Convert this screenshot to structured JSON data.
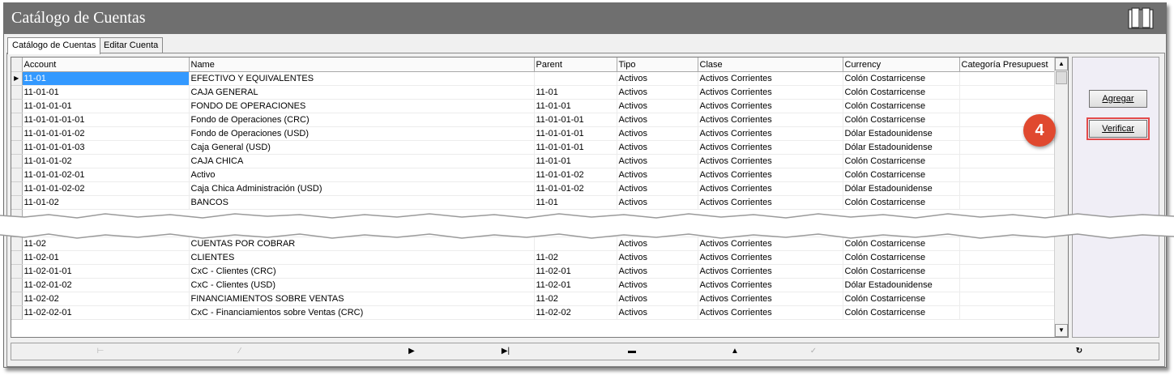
{
  "window": {
    "title": "Catálogo de Cuentas"
  },
  "tabs": [
    {
      "label": "Catálogo de Cuentas"
    },
    {
      "label": "Editar Cuenta"
    }
  ],
  "grid": {
    "columns": [
      "Account",
      "Name",
      "Parent",
      "Tipo",
      "Clase",
      "Currency",
      "Categoría Presupuest"
    ],
    "rows_top": [
      [
        "11-01",
        "EFECTIVO Y EQUIVALENTES",
        "",
        "Activos",
        "Activos Corrientes",
        "Colón Costarricense",
        ""
      ],
      [
        "11-01-01",
        "CAJA GENERAL",
        "11-01",
        "Activos",
        "Activos Corrientes",
        "Colón Costarricense",
        ""
      ],
      [
        "11-01-01-01",
        "FONDO DE OPERACIONES",
        "11-01-01",
        "Activos",
        "Activos Corrientes",
        "Colón Costarricense",
        ""
      ],
      [
        "11-01-01-01-01",
        "Fondo de Operaciones (CRC)",
        "11-01-01-01",
        "Activos",
        "Activos Corrientes",
        "Colón Costarricense",
        ""
      ],
      [
        "11-01-01-01-02",
        "Fondo de Operaciones (USD)",
        "11-01-01-01",
        "Activos",
        "Activos Corrientes",
        "Dólar Estadounidense",
        ""
      ],
      [
        "11-01-01-01-03",
        "Caja General (USD)",
        "11-01-01-01",
        "Activos",
        "Activos Corrientes",
        "Dólar Estadounidense",
        ""
      ],
      [
        "11-01-01-02",
        "CAJA CHICA",
        "11-01-01",
        "Activos",
        "Activos Corrientes",
        "Colón Costarricense",
        ""
      ],
      [
        "11-01-01-02-01",
        "Activo",
        "11-01-01-02",
        "Activos",
        "Activos Corrientes",
        "Colón Costarricense",
        ""
      ],
      [
        "11-01-01-02-02",
        "Caja Chica Administración (USD)",
        "11-01-01-02",
        "Activos",
        "Activos Corrientes",
        "Dólar Estadounidense",
        ""
      ],
      [
        "11-01-02",
        "BANCOS",
        "11-01",
        "Activos",
        "Activos Corrientes",
        "Colón Costarricense",
        ""
      ]
    ],
    "rows_bottom": [
      [
        "11-02",
        "CUENTAS POR COBRAR",
        "",
        "Activos",
        "Activos Corrientes",
        "Colón Costarricense",
        ""
      ],
      [
        "11-02-01",
        "CLIENTES",
        "11-02",
        "Activos",
        "Activos Corrientes",
        "Colón Costarricense",
        ""
      ],
      [
        "11-02-01-01",
        "CxC - Clientes (CRC)",
        "11-02-01",
        "Activos",
        "Activos Corrientes",
        "Colón Costarricense",
        ""
      ],
      [
        "11-02-01-02",
        "CxC - Clientes (USD)",
        "11-02-01",
        "Activos",
        "Activos Corrientes",
        "Dólar Estadounidense",
        ""
      ],
      [
        "11-02-02",
        "FINANCIAMIENTOS SOBRE VENTAS",
        "11-02",
        "Activos",
        "Activos Corrientes",
        "Colón Costarricense",
        ""
      ],
      [
        "11-02-02-01",
        "CxC - Financiamientos sobre Ventas (CRC)",
        "11-02-02",
        "Activos",
        "Activos Corrientes",
        "Colón Costarricense",
        ""
      ]
    ]
  },
  "buttons": {
    "add": "Agregar",
    "verify": "Verificar"
  },
  "callout": {
    "step": "4"
  },
  "navigator": {
    "first": "first-icon",
    "prev": "prev-icon",
    "next": "next-icon",
    "last": "last-icon",
    "delete": "minus-icon",
    "edit": "up-icon",
    "post": "check-icon",
    "refresh": "refresh-icon"
  },
  "colors": {
    "titlebar": "#6f6f6f",
    "selection": "#3399ff",
    "callout": "#e0492f",
    "highlight": "#e34b4b"
  }
}
